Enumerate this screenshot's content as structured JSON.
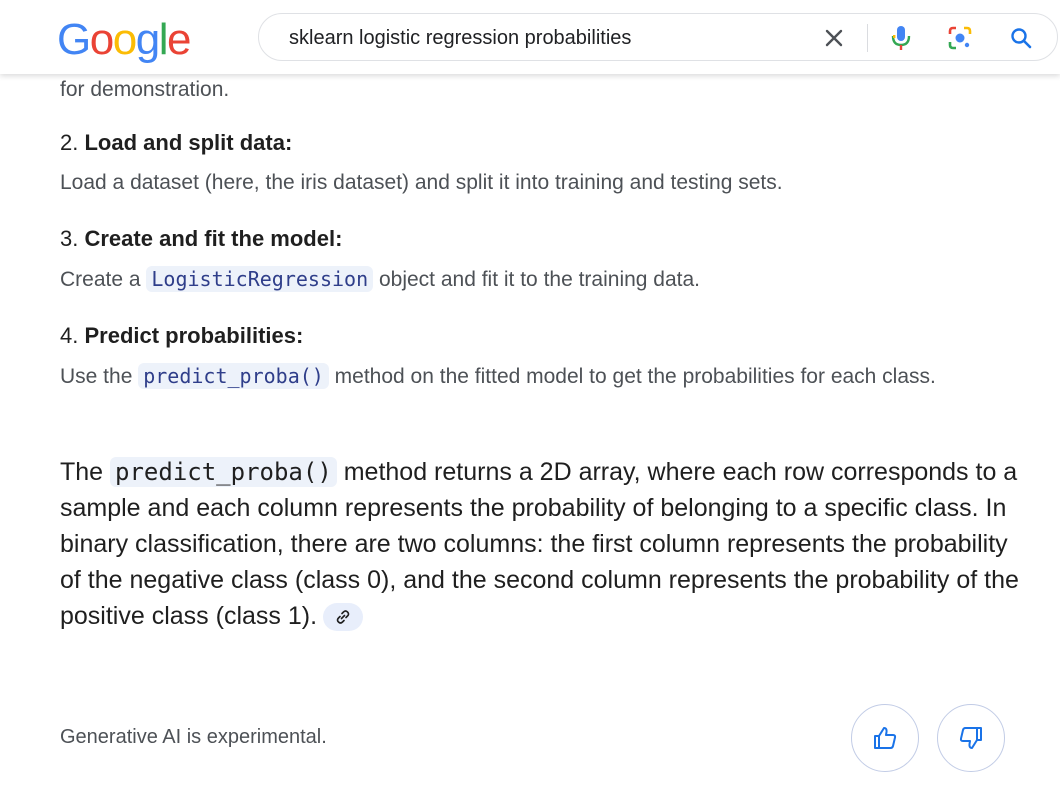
{
  "header": {
    "logo_letters": [
      "G",
      "o",
      "o",
      "g",
      "l",
      "e"
    ],
    "logo_colors": [
      "#4285F4",
      "#EA4335",
      "#FBBC05",
      "#4285F4",
      "#34A853",
      "#EA4335"
    ],
    "search_query": "sklearn logistic regression probabilities",
    "icons": [
      "close-icon",
      "microphone-icon",
      "lens-icon",
      "search-icon"
    ]
  },
  "content": {
    "fragment": "for demonstration.",
    "steps": [
      {
        "num": "2.",
        "title": "Load and split data:",
        "desc": "Load a dataset (here, the iris dataset) and split it into training and testing sets."
      },
      {
        "num": "3.",
        "title": "Create and fit the model:",
        "desc_pre": "Create a ",
        "code": "LogisticRegression",
        "desc_post": " object and fit it to the training data."
      },
      {
        "num": "4.",
        "title": "Predict probabilities:",
        "desc_pre": "Use the ",
        "code": "predict_proba()",
        "desc_post": " method on the fitted model to get the probabilities for each class."
      }
    ],
    "paragraph": {
      "pre": "The ",
      "code": "predict_proba()",
      "post": " method returns a 2D array, where each row corresponds to a sample and each column represents the probability of belonging to a specific class. In binary classification, there are two columns: the first column represents the probability of the negative class (class 0), and the second column represents the probability of the positive class (class 1)."
    }
  },
  "footer": {
    "note": "Generative AI is experimental."
  },
  "colors": {
    "accent": "#1a73e8",
    "code_bg": "#edf2fa",
    "code_text": "#2f3e8a"
  }
}
